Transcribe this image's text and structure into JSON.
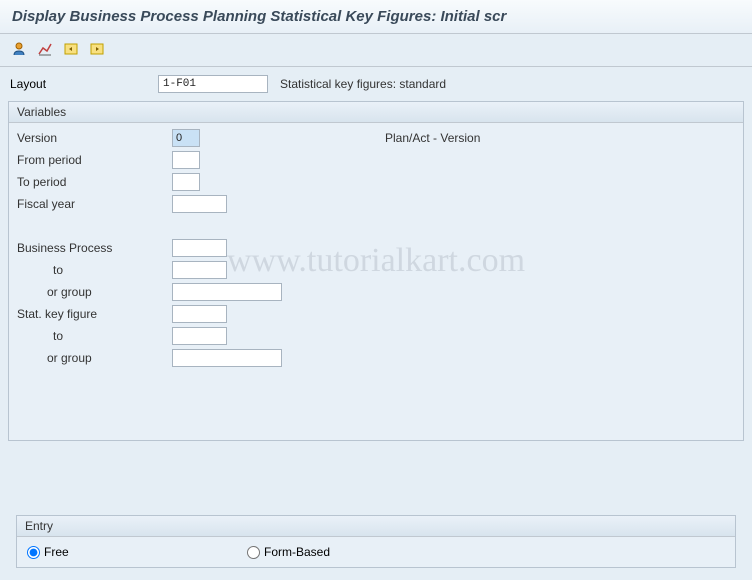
{
  "title": "Display Business Process Planning Statistical Key Figures: Initial scr",
  "layout": {
    "label": "Layout",
    "value": "1-F01",
    "desc": "Statistical key figures: standard"
  },
  "variables": {
    "title": "Variables",
    "version": {
      "label": "Version",
      "value": "0",
      "desc": "Plan/Act - Version"
    },
    "from_period": {
      "label": "From period",
      "value": ""
    },
    "to_period": {
      "label": "To period",
      "value": ""
    },
    "fiscal_year": {
      "label": "Fiscal year",
      "value": ""
    },
    "business_process": {
      "label": "Business Process",
      "value": ""
    },
    "bp_to": {
      "label": "to",
      "value": ""
    },
    "bp_group": {
      "label": "or group",
      "value": ""
    },
    "stat_key": {
      "label": "Stat. key figure",
      "value": ""
    },
    "sk_to": {
      "label": "to",
      "value": ""
    },
    "sk_group": {
      "label": "or group",
      "value": ""
    }
  },
  "entry": {
    "title": "Entry",
    "free": "Free",
    "form": "Form-Based",
    "selected": "free"
  },
  "watermark": "www.tutorialkart.com"
}
